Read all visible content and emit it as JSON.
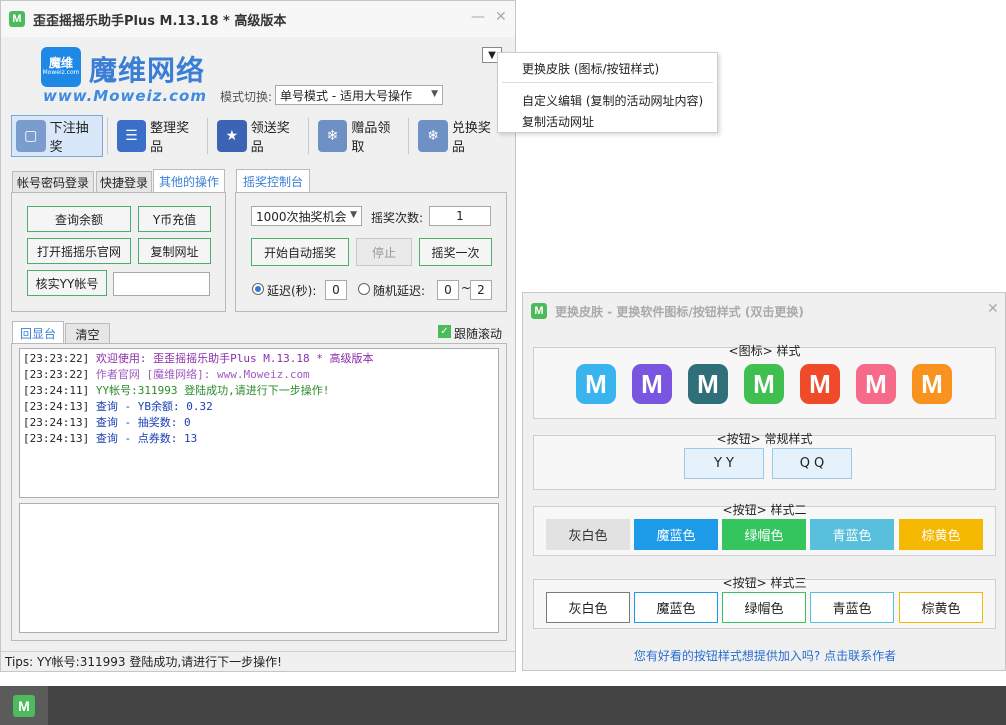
{
  "main_window": {
    "title": "歪歪摇摇乐助手Plus M.13.18 * 高级版本",
    "app_badge": "M",
    "logo": {
      "square_text": "魔维",
      "square_sub": "Moweiz.com",
      "text": "魔维网络",
      "url": "www.Moweiz.com"
    },
    "mode_label": "模式切换:",
    "mode_value": "单号模式 - 适用大号操作",
    "dropdown_arrow": "▼",
    "toolbar": [
      {
        "label": "下注抽奖",
        "icon": "cube-icon",
        "color": "#7a9ccf"
      },
      {
        "label": "整理奖品",
        "icon": "list-icon",
        "color": "#3a6fc8"
      },
      {
        "label": "领送奖品",
        "icon": "star-gift-icon",
        "color": "#3d63b5"
      },
      {
        "label": "赠品领取",
        "icon": "snowflake-icon",
        "color": "#6f90c4"
      },
      {
        "label": "兑换奖品",
        "icon": "snowflake-icon",
        "color": "#6f90c4"
      }
    ],
    "left_tabs": [
      "帐号密码登录",
      "快捷登录",
      "其他的操作"
    ],
    "other_ops": {
      "query_balance": "查询余额",
      "recharge": "Y币充值",
      "open_site": "打开摇摇乐官网",
      "copy_url": "复制网址",
      "verify_account": "核实YY帐号",
      "verify_input": ""
    },
    "right_tab": "摇奖控制台",
    "control": {
      "count_select": "1000次抽奖机会",
      "times_label": "摇奖次数:",
      "times_value": "1",
      "start_auto": "开始自动摇奖",
      "stop": "停止",
      "once": "摇奖一次",
      "delay_label": "延迟(秒):",
      "delay_value": "0",
      "random_label": "随机延迟:",
      "random_from": "0",
      "random_sep": "~",
      "random_to": "2"
    },
    "log_tabs": [
      "回显台",
      "清空"
    ],
    "follow_scroll": "跟随滚动",
    "log_lines": [
      {
        "ts": "[23:23:22]",
        "text": " 欢迎使用: 歪歪摇摇乐助手Plus M.13.18 * 高级版本",
        "color": "#8a2ea8"
      },
      {
        "ts": "[23:23:22]",
        "text": " 作者官网 [魔维网络]: www.Moweiz.com",
        "color": "#a05ac0"
      },
      {
        "ts": "[23:24:11]",
        "text": " YY帐号:311993 登陆成功,请进行下一步操作!",
        "color": "#2b8a2b"
      },
      {
        "ts": "[23:24:13]",
        "text": " 查询 - YB余额: 0.32",
        "color": "#1a3db5"
      },
      {
        "ts": "[23:24:13]",
        "text": " 查询 - 抽奖数: 0",
        "color": "#1a3db5"
      },
      {
        "ts": "[23:24:13]",
        "text": " 查询 - 点券数: 13",
        "color": "#1a3db5"
      }
    ],
    "status": "Tips:  YY帐号:311993 登陆成功,请进行下一步操作!"
  },
  "context_menu": {
    "items": [
      "更换皮肤 (图标/按钮样式)",
      "自定义编辑 (复制的活动网址内容)",
      "复制活动网址"
    ]
  },
  "skin_window": {
    "title": "更换皮肤 - 更换软件图标/按钮样式 (双击更换)",
    "icon_group_title": "<图标> 样式",
    "icon_letter": "M",
    "icon_colors": [
      "#3ab4ee",
      "#7a56e0",
      "#2f6f7a",
      "#3fbf4f",
      "#ef4a2a",
      "#f76a8a",
      "#f7931e"
    ],
    "normal_group_title": "<按钮> 常规样式",
    "normal_buttons": [
      "Y Y",
      "Q Q"
    ],
    "style2_title": "<按钮> 样式二",
    "style2_buttons": [
      {
        "label": "灰白色",
        "bg": "#e2e2e2",
        "fg": "#333333"
      },
      {
        "label": "魔蓝色",
        "bg": "#1e9be8",
        "fg": "#ffffff"
      },
      {
        "label": "绿帽色",
        "bg": "#35c55f",
        "fg": "#ffffff"
      },
      {
        "label": "青蓝色",
        "bg": "#58bfdc",
        "fg": "#ffffff"
      },
      {
        "label": "棕黄色",
        "bg": "#f5b800",
        "fg": "#ffffff"
      }
    ],
    "style3_title": "<按钮> 样式三",
    "style3_buttons": [
      {
        "label": "灰白色",
        "border": "#7a7a7a"
      },
      {
        "label": "魔蓝色",
        "border": "#1e9be8"
      },
      {
        "label": "绿帽色",
        "border": "#35c55f"
      },
      {
        "label": "青蓝色",
        "border": "#58bfdc"
      },
      {
        "label": "棕黄色",
        "border": "#f5b800"
      }
    ],
    "contact": "您有好看的按钮样式想提供加入吗? 点击联系作者"
  },
  "taskbar": {
    "app_badge": "M"
  }
}
